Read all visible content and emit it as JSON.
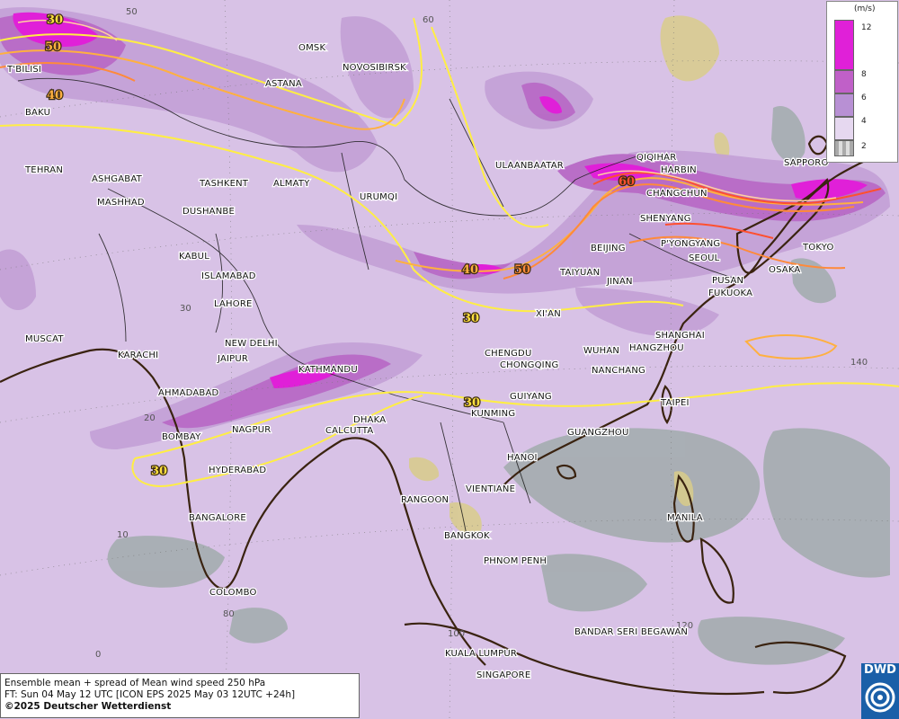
{
  "legend": {
    "unit": "(m/s)",
    "ticks": [
      "12",
      "8",
      "6",
      "4",
      "2"
    ],
    "colors": [
      "#e020d8",
      "#c060c8",
      "#b890d4",
      "#cfb8e0",
      "#bbbbbb"
    ]
  },
  "info": {
    "line1": "Ensemble mean + spread of Mean wind speed 250 hPa",
    "line2": "FT: Sun 04 May 12 UTC [ICON EPS 2025 May 03 12UTC +24h]",
    "line3": "©2025 Deutscher Wetterdienst"
  },
  "logo": {
    "text": "DWD"
  },
  "contour_labels": [
    "30",
    "50",
    "40",
    "60",
    "40",
    "50",
    "30",
    "30",
    "30"
  ],
  "grid_labels": [
    "50",
    "60",
    "30",
    "20",
    "10",
    "0",
    "80",
    "100",
    "120",
    "140"
  ],
  "cities": [
    "OMSK",
    "NOVOSIBIRSK",
    "ASTANA",
    "T'BILISI",
    "BAKU",
    "TEHRAN",
    "ASHGABAT",
    "MASHHAD",
    "TASHKENT",
    "ALMATY",
    "DUSHANBE",
    "URUMQI",
    "ULAANBAATAR",
    "QIQIHAR",
    "HARBIN",
    "CHANGCHUN",
    "SHENYANG",
    "SAPPORO",
    "P'YONGYANG",
    "SEOUL",
    "TOKYO",
    "BEIJING",
    "TAIYUAN",
    "JINAN",
    "PUSAN",
    "OSAKA",
    "FUKUOKA",
    "KABUL",
    "ISLAMABAD",
    "LAHORE",
    "NEW DELHI",
    "JAIPUR",
    "KARACHI",
    "MUSCAT",
    "AHMADABAD",
    "KATHMANDU",
    "XI'AN",
    "SHANGHAI",
    "HANGZHOU",
    "CHENGDU",
    "CHONGQING",
    "WUHAN",
    "NANCHANG",
    "TAIPEI",
    "GUIYANG",
    "KUNMING",
    "DHAKA",
    "CALCUTTA",
    "NAGPUR",
    "BOMBAY",
    "HYDERABAD",
    "GUANGZHOU",
    "HANOI",
    "VIENTIANE",
    "RANGOON",
    "BANGKOK",
    "MANILA",
    "BANGALORE",
    "PHNOM PENH",
    "COLOMBO",
    "BANDAR SERI BEGAWAN",
    "KUALA LUMPUR",
    "SINGAPORE"
  ]
}
